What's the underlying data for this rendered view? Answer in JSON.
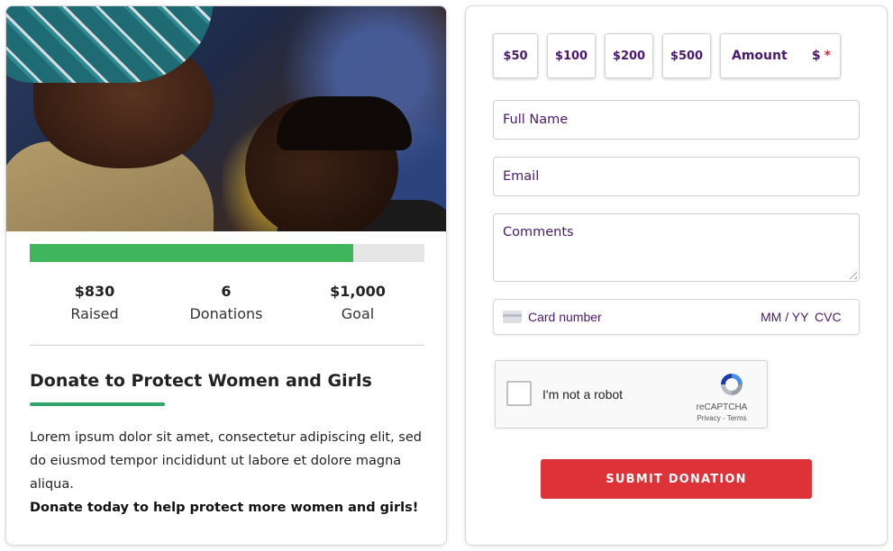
{
  "campaign": {
    "progress_fraction": 0.82,
    "stats": {
      "raised_value": "$830",
      "raised_label": "Raised",
      "donations_value": "6",
      "donations_label": "Donations",
      "goal_value": "$1,000",
      "goal_label": "Goal"
    },
    "title": "Donate to Protect Women and Girls",
    "description": "Lorem ipsum dolor sit amet, consectetur adipiscing elit, sed do eiusmod tempor incididunt ut labore et dolore magna aliqua.",
    "call_to_action": "Donate today to help protect more women and girls!"
  },
  "form": {
    "amounts": [
      "$50",
      "$100",
      "$200",
      "$500"
    ],
    "custom_amount_placeholder": "Amount",
    "currency_symbol": "$",
    "required_marker": "*",
    "fullname_placeholder": "Full Name",
    "email_placeholder": "Email",
    "comments_placeholder": "Comments",
    "card": {
      "number_placeholder": "Card number",
      "expiry_placeholder": "MM / YY",
      "cvc_placeholder": "CVC"
    },
    "recaptcha": {
      "label": "I'm not a robot",
      "brand": "reCAPTCHA",
      "links": "Privacy - Terms"
    },
    "submit_label": "SUBMIT DONATION"
  },
  "colors": {
    "progress_fill": "#3fb65b",
    "accent_underline": "#2ea66a",
    "submit_bg": "#dc3238",
    "form_text": "#4a1870"
  }
}
